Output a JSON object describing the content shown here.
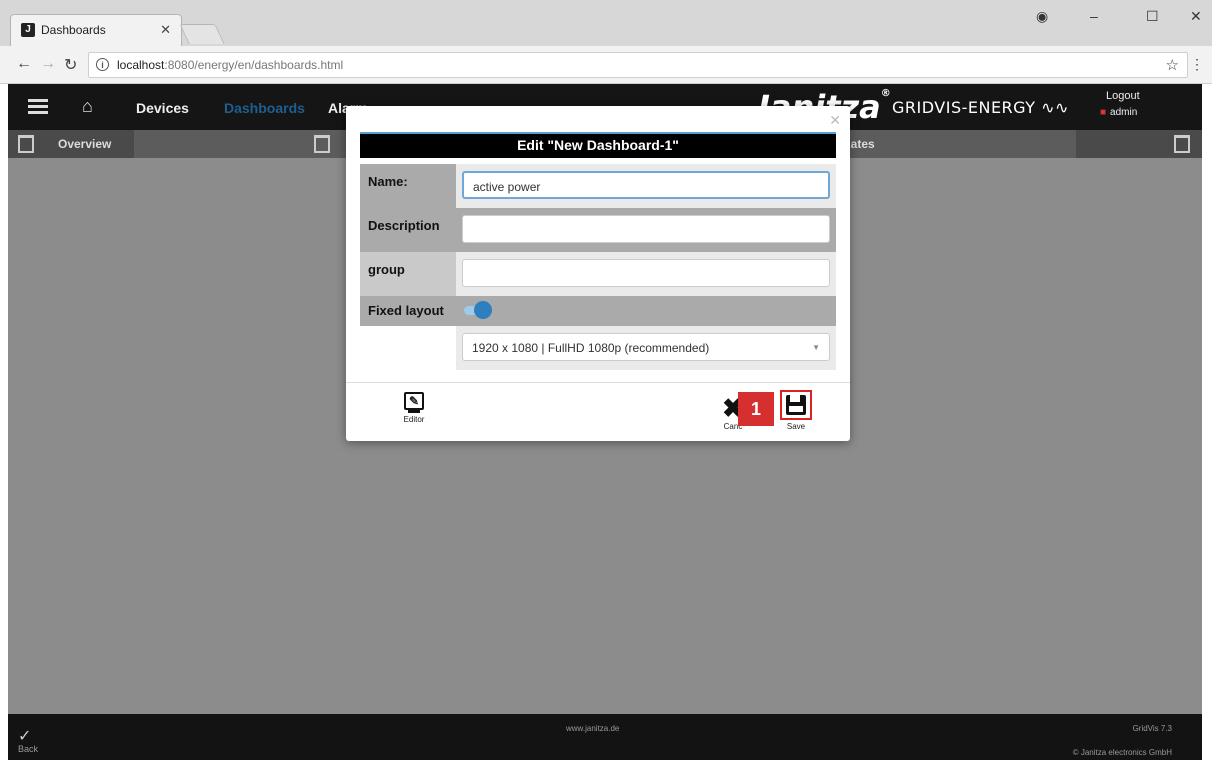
{
  "browser": {
    "tab_title": "Dashboards",
    "tab_favicon": "J",
    "url_host": "localhost",
    "url_path": ":8080/energy/en/dashboards.html"
  },
  "app": {
    "nav": {
      "devices": "Devices",
      "dashboards": "Dashboards",
      "alarm": "Alarm"
    },
    "logo_text": "Janitza",
    "product_text": "GRIDVIS-ENERGY",
    "logout_label": "Logout",
    "user_name": "admin",
    "subnav": {
      "overview": "Overview",
      "templates": "plates"
    },
    "footer": {
      "back": "Back",
      "website": "www.janitza.de",
      "version": "GridVis 7.3",
      "copyright": "© Janitza electronics GmbH"
    },
    "colors": {
      "active_nav": "#1f5f8f",
      "accent": "#2f7fbf",
      "highlight": "#d5302f"
    }
  },
  "modal": {
    "title": "Edit \"New Dashboard-1\"",
    "fields": {
      "name_label": "Name:",
      "name_value": "active power",
      "description_label": "Description",
      "description_value": "",
      "group_label": "group",
      "group_value": "",
      "fixed_layout_label": "Fixed layout",
      "fixed_layout_on": true,
      "resolution_value": "1920 x 1080 | FullHD 1080p (recommended)"
    },
    "buttons": {
      "editor": "Editor",
      "cancel": "Canc",
      "save": "Save"
    },
    "step_badge": "1"
  }
}
